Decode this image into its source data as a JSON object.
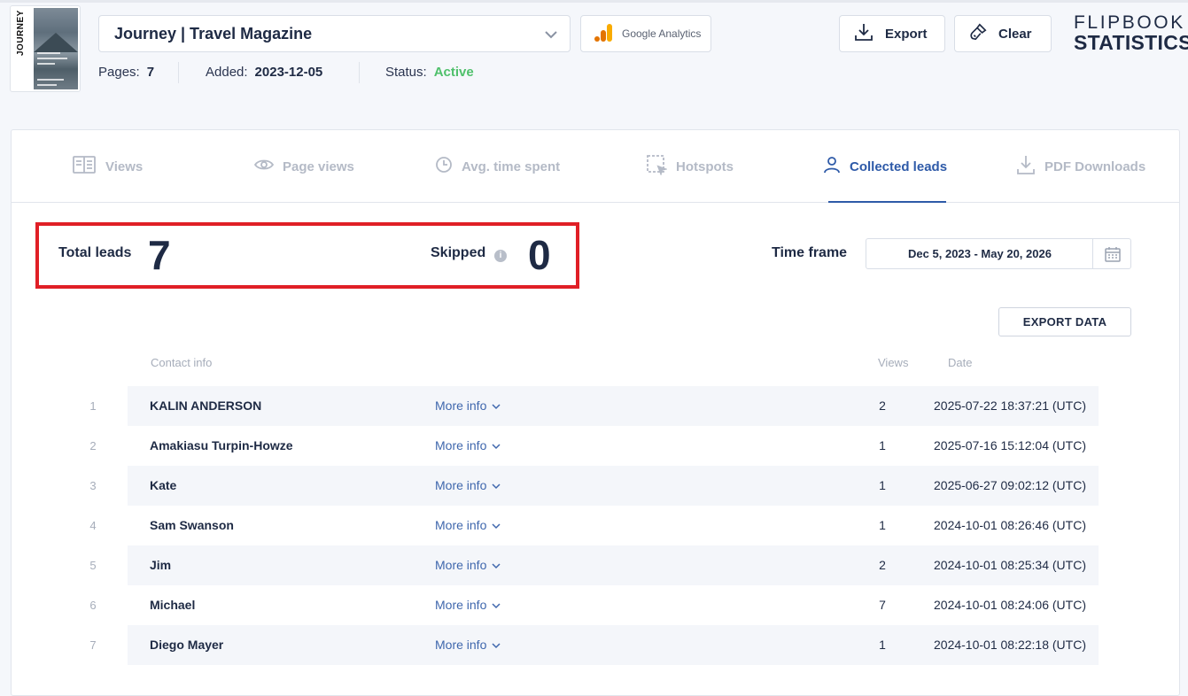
{
  "header": {
    "cover_title": "JOURNEY",
    "flipbook_title": "Journey | Travel Magazine",
    "analytics_label": "Google Analytics",
    "pages_label": "Pages:",
    "pages_value": "7",
    "added_label": "Added:",
    "added_value": "2023-12-05",
    "status_label": "Status:",
    "status_value": "Active",
    "export_label": "Export",
    "clear_label": "Clear",
    "brand_line1": "FLIPBOOK",
    "brand_line2": "STATISTICS"
  },
  "tabs": [
    {
      "label": "Views",
      "icon": "views-icon"
    },
    {
      "label": "Page views",
      "icon": "eye-icon"
    },
    {
      "label": "Avg. time spent",
      "icon": "clock-icon"
    },
    {
      "label": "Hotspots",
      "icon": "hotspot-icon"
    },
    {
      "label": "Collected leads",
      "icon": "user-icon",
      "active": true
    },
    {
      "label": "PDF Downloads",
      "icon": "download-icon"
    }
  ],
  "summary": {
    "total_label": "Total leads",
    "total_value": "7",
    "skipped_label": "Skipped",
    "skipped_value": "0"
  },
  "timeframe": {
    "label": "Time frame",
    "value": "Dec 5, 2023 - May 20, 2026"
  },
  "export_data_label": "EXPORT DATA",
  "table": {
    "headers": {
      "contact": "Contact info",
      "views": "Views",
      "date": "Date"
    },
    "more_label": "More info",
    "rows": [
      {
        "num": "1",
        "name": "KALIN ANDERSON",
        "views": "2",
        "date": "2025-07-22 18:37:21 (UTC)"
      },
      {
        "num": "2",
        "name": "Amakiasu Turpin-Howze",
        "views": "1",
        "date": "2025-07-16 15:12:04 (UTC)"
      },
      {
        "num": "3",
        "name": "Kate",
        "views": "1",
        "date": "2025-06-27 09:02:12 (UTC)"
      },
      {
        "num": "4",
        "name": "Sam Swanson",
        "views": "1",
        "date": "2024-10-01 08:26:46 (UTC)"
      },
      {
        "num": "5",
        "name": "Jim",
        "views": "2",
        "date": "2024-10-01 08:25:34 (UTC)"
      },
      {
        "num": "6",
        "name": "Michael",
        "views": "7",
        "date": "2024-10-01 08:24:06 (UTC)"
      },
      {
        "num": "7",
        "name": "Diego Mayer",
        "views": "1",
        "date": "2024-10-01 08:22:18 (UTC)"
      }
    ]
  },
  "colors": {
    "accent": "#2e5aa8",
    "active_status": "#4fc06b",
    "highlight_border": "#e01f26"
  }
}
